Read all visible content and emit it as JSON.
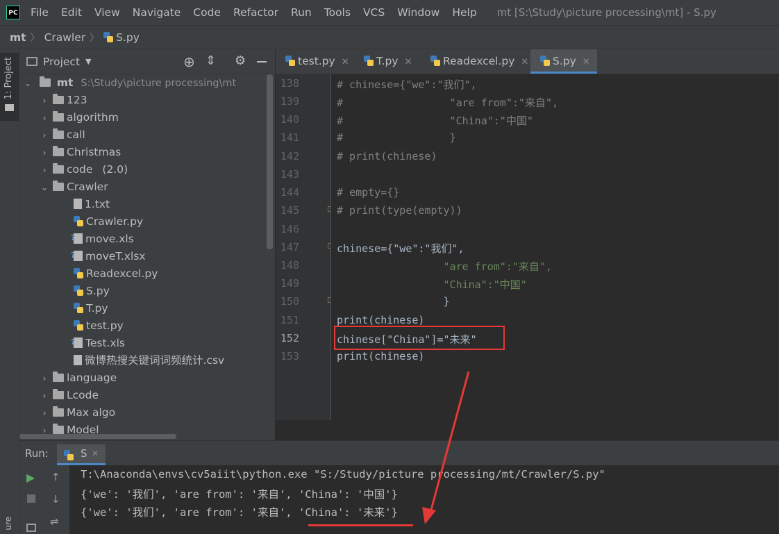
{
  "menubar": {
    "logo": "PC",
    "items": [
      "File",
      "Edit",
      "View",
      "Navigate",
      "Code",
      "Refactor",
      "Run",
      "Tools",
      "VCS",
      "Window",
      "Help"
    ],
    "window_title": "mt [S:\\Study\\picture processing\\mt] - S.py"
  },
  "breadcrumb": {
    "items": [
      "mt",
      "Crawler",
      "S.py"
    ]
  },
  "left_stripe": {
    "project_label": "1: Project",
    "structure_label": "ure"
  },
  "project_panel": {
    "title": "Project",
    "root_name": "mt",
    "root_path": "S:\\Study\\picture processing\\mt",
    "tree": [
      {
        "label": "123",
        "type": "folder",
        "expanded": false
      },
      {
        "label": "algorithm",
        "type": "folder",
        "expanded": false
      },
      {
        "label": "call",
        "type": "folder",
        "expanded": false
      },
      {
        "label": "Christmas",
        "type": "folder",
        "expanded": false
      },
      {
        "label": "code",
        "type": "folder",
        "expanded": false,
        "suffix": "(2.0)"
      },
      {
        "label": "Crawler",
        "type": "folder",
        "expanded": true
      },
      {
        "label": "1.txt",
        "type": "text",
        "child": true
      },
      {
        "label": "Crawler.py",
        "type": "python",
        "child": true
      },
      {
        "label": "move.xls",
        "type": "unknown",
        "child": true
      },
      {
        "label": "moveT.xlsx",
        "type": "unknown",
        "child": true
      },
      {
        "label": "Readexcel.py",
        "type": "python",
        "child": true
      },
      {
        "label": "S.py",
        "type": "python",
        "child": true
      },
      {
        "label": "T.py",
        "type": "python",
        "child": true
      },
      {
        "label": "test.py",
        "type": "python",
        "child": true
      },
      {
        "label": "Test.xls",
        "type": "unknown",
        "child": true
      },
      {
        "label": "微博热搜关键词词频统计.csv",
        "type": "text",
        "child": true
      },
      {
        "label": "language",
        "type": "folder",
        "expanded": false
      },
      {
        "label": "Lcode",
        "type": "folder",
        "expanded": false
      },
      {
        "label": "Max algo",
        "type": "folder",
        "expanded": false
      },
      {
        "label": "Model",
        "type": "folder",
        "expanded": false
      }
    ]
  },
  "editor_tabs": [
    {
      "label": "test.py",
      "active": false
    },
    {
      "label": "T.py",
      "active": false
    },
    {
      "label": "Readexcel.py",
      "active": false
    },
    {
      "label": "S.py",
      "active": true
    }
  ],
  "editor": {
    "lines": [
      {
        "n": "138",
        "text": "# chinese={\"we\":\"我们\","
      },
      {
        "n": "139",
        "text": "#                 \"are from\":\"来自\","
      },
      {
        "n": "140",
        "text": "#                 \"China\":\"中国\""
      },
      {
        "n": "141",
        "text": "#                 }"
      },
      {
        "n": "142",
        "text": "# print(chinese)"
      },
      {
        "n": "143",
        "text": ""
      },
      {
        "n": "144",
        "text": "# empty={}"
      },
      {
        "n": "145",
        "text": "# print(type(empty))"
      },
      {
        "n": "146",
        "text": ""
      },
      {
        "n": "147",
        "text": "chinese={\"we\":\"我们\","
      },
      {
        "n": "148",
        "text": "                 \"are from\":\"来自\","
      },
      {
        "n": "149",
        "text": "                 \"China\":\"中国\""
      },
      {
        "n": "150",
        "text": "                 }"
      },
      {
        "n": "151",
        "text": "print(chinese)"
      },
      {
        "n": "152",
        "text": "chinese[\"China\"]=\"未来\""
      },
      {
        "n": "153",
        "text": "print(chinese)"
      }
    ],
    "current_line": "152"
  },
  "run_panel": {
    "label": "Run:",
    "tab": "S",
    "output": [
      "T:\\Anaconda\\envs\\cv5aiit\\python.exe \"S:/Study/picture processing/mt/Crawler/S.py\"",
      "{'we': '我们', 'are from': '来自', 'China': '中国'}",
      "{'we': '我们', 'are from': '来自', 'China': '未来'}"
    ]
  },
  "colors": {
    "accent": "#4a88c7",
    "annotation_red": "#e53935",
    "string_green": "#6a8759",
    "comment_gray": "#808080",
    "builtin_purple": "#8888c6"
  }
}
